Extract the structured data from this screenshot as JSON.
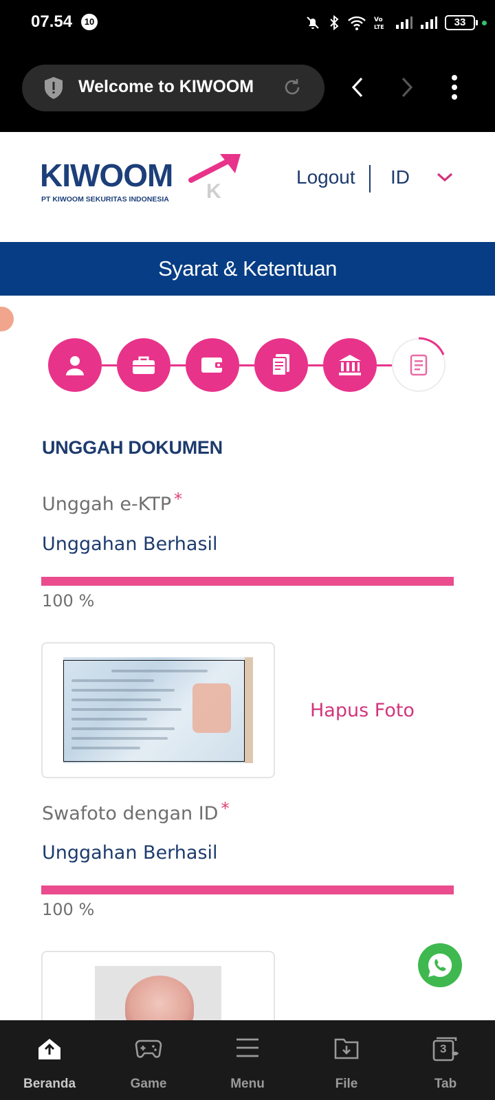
{
  "status_bar": {
    "time": "07.54",
    "notification_count": "10",
    "battery": "33"
  },
  "browser": {
    "tab_title": "Welcome to KIWOOM"
  },
  "header": {
    "logo_text": "KIWOOM",
    "logo_subtitle": "PT KIWOOM SEKURITAS INDONESIA",
    "logout_label": "Logout",
    "language": "ID"
  },
  "page": {
    "title": "Syarat & Ketentuan"
  },
  "stepper": {
    "steps": [
      {
        "icon": "user-icon",
        "state": "complete"
      },
      {
        "icon": "briefcase-icon",
        "state": "complete"
      },
      {
        "icon": "wallet-icon",
        "state": "complete"
      },
      {
        "icon": "document-icon",
        "state": "complete"
      },
      {
        "icon": "bank-icon",
        "state": "complete"
      },
      {
        "icon": "document-icon",
        "state": "current"
      }
    ]
  },
  "upload": {
    "section_title": "UNGGAH DOKUMEN",
    "ktp": {
      "label": "Unggah e-KTP",
      "required_mark": "*",
      "status": "Unggahan Berhasil",
      "progress": 100,
      "progress_text": "100 %",
      "delete_label": "Hapus Foto"
    },
    "selfie": {
      "label": "Swafoto dengan ID",
      "required_mark": "*",
      "status": "Unggahan Berhasil",
      "progress": 100,
      "progress_text": "100 %"
    }
  },
  "bottom_nav": {
    "items": [
      {
        "label": "Beranda",
        "icon": "home-upload-icon"
      },
      {
        "label": "Game",
        "icon": "gamepad-icon"
      },
      {
        "label": "Menu",
        "icon": "menu-icon"
      },
      {
        "label": "File",
        "icon": "download-folder-icon"
      },
      {
        "label": "Tab",
        "icon": "tabs-icon",
        "count": "3"
      }
    ]
  },
  "colors": {
    "brand_pink": "#e8338a",
    "brand_navy": "#063d85",
    "text_navy": "#1d3b6e",
    "progress": "#ea4c8e",
    "whatsapp": "#3fb84f"
  }
}
